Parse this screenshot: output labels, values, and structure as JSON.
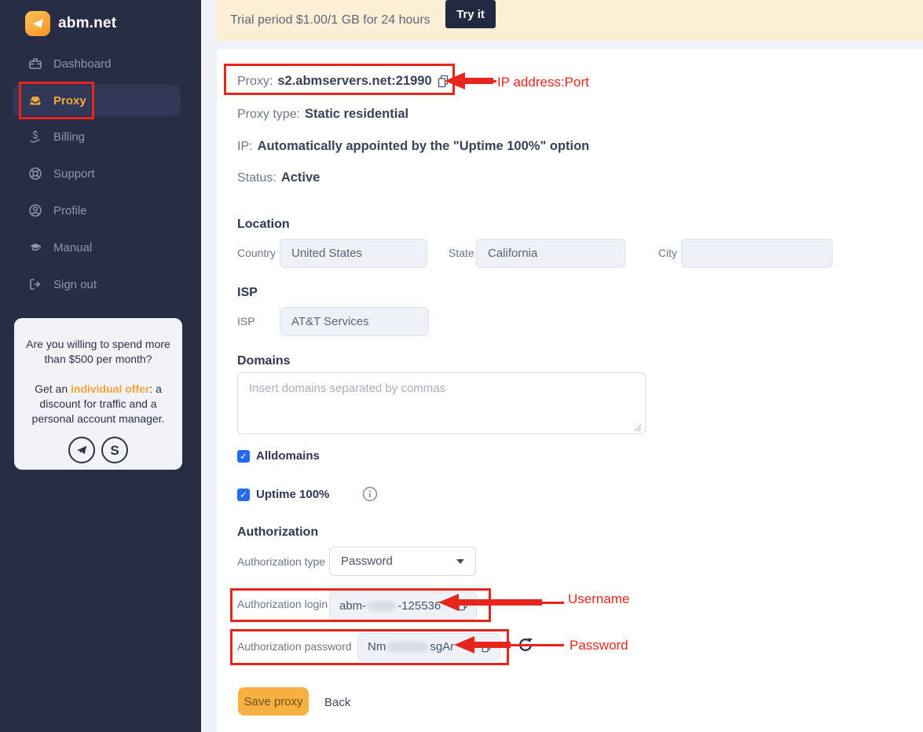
{
  "colors": {
    "sidebar_bg": "#272d45",
    "accent_orange": "#f2a93c",
    "annotation_red": "#e8251d",
    "status_green": "#27a567",
    "checkbox_blue": "#2569f1",
    "topbar_cream": "#fcefd6",
    "tryit_navy": "#222a42",
    "save_orange": "#f8b042"
  },
  "sidebar": {
    "brand": "abm.net",
    "items": [
      {
        "label": "Dashboard"
      },
      {
        "label": "Proxy"
      },
      {
        "label": "Billing"
      },
      {
        "label": "Support"
      },
      {
        "label": "Profile"
      },
      {
        "label": "Manual"
      },
      {
        "label": "Sign out"
      }
    ],
    "promo": {
      "line1": "Are you willing to spend more than $500 per month?",
      "line2_prefix": "Get an ",
      "line2_link": "individual offer",
      "line2_suffix": ": a discount for traffic and a personal account manager."
    }
  },
  "topbar": {
    "text": "Trial period $1.00/1 GB for 24 hours",
    "button": "Try it"
  },
  "proxy": {
    "proxy_label": "Proxy:",
    "proxy_value": "s2.abmservers.net:21990",
    "type_label": "Proxy type:",
    "type_value": "Static residential",
    "ip_label": "IP:",
    "ip_value": "Automatically appointed by the \"Uptime 100%\" option",
    "status_label": "Status:",
    "status_value": "Active"
  },
  "location": {
    "heading": "Location",
    "country_label": "Country",
    "country_value": "United States",
    "state_label": "State",
    "state_value": "California",
    "city_label": "City",
    "city_value": ""
  },
  "isp": {
    "heading": "ISP",
    "label": "ISP",
    "value": "AT&T Services"
  },
  "domains": {
    "heading": "Domains",
    "placeholder": "Insert domains separated by commas",
    "alldomains_label": "Alldomains",
    "uptime_label": "Uptime 100%"
  },
  "authorization": {
    "heading": "Authorization",
    "type_label": "Authorization type",
    "type_value": "Password",
    "login_label": "Authorization login",
    "login_prefix": "abm-",
    "login_suffix": "-125536",
    "password_label": "Authorization password",
    "password_prefix": "Nm",
    "password_suffix": "sgAr"
  },
  "actions": {
    "save": "Save proxy",
    "back": "Back"
  },
  "annotations": {
    "proxy_note": "IP address:Port",
    "login_note": "Username",
    "password_note": "Password"
  }
}
